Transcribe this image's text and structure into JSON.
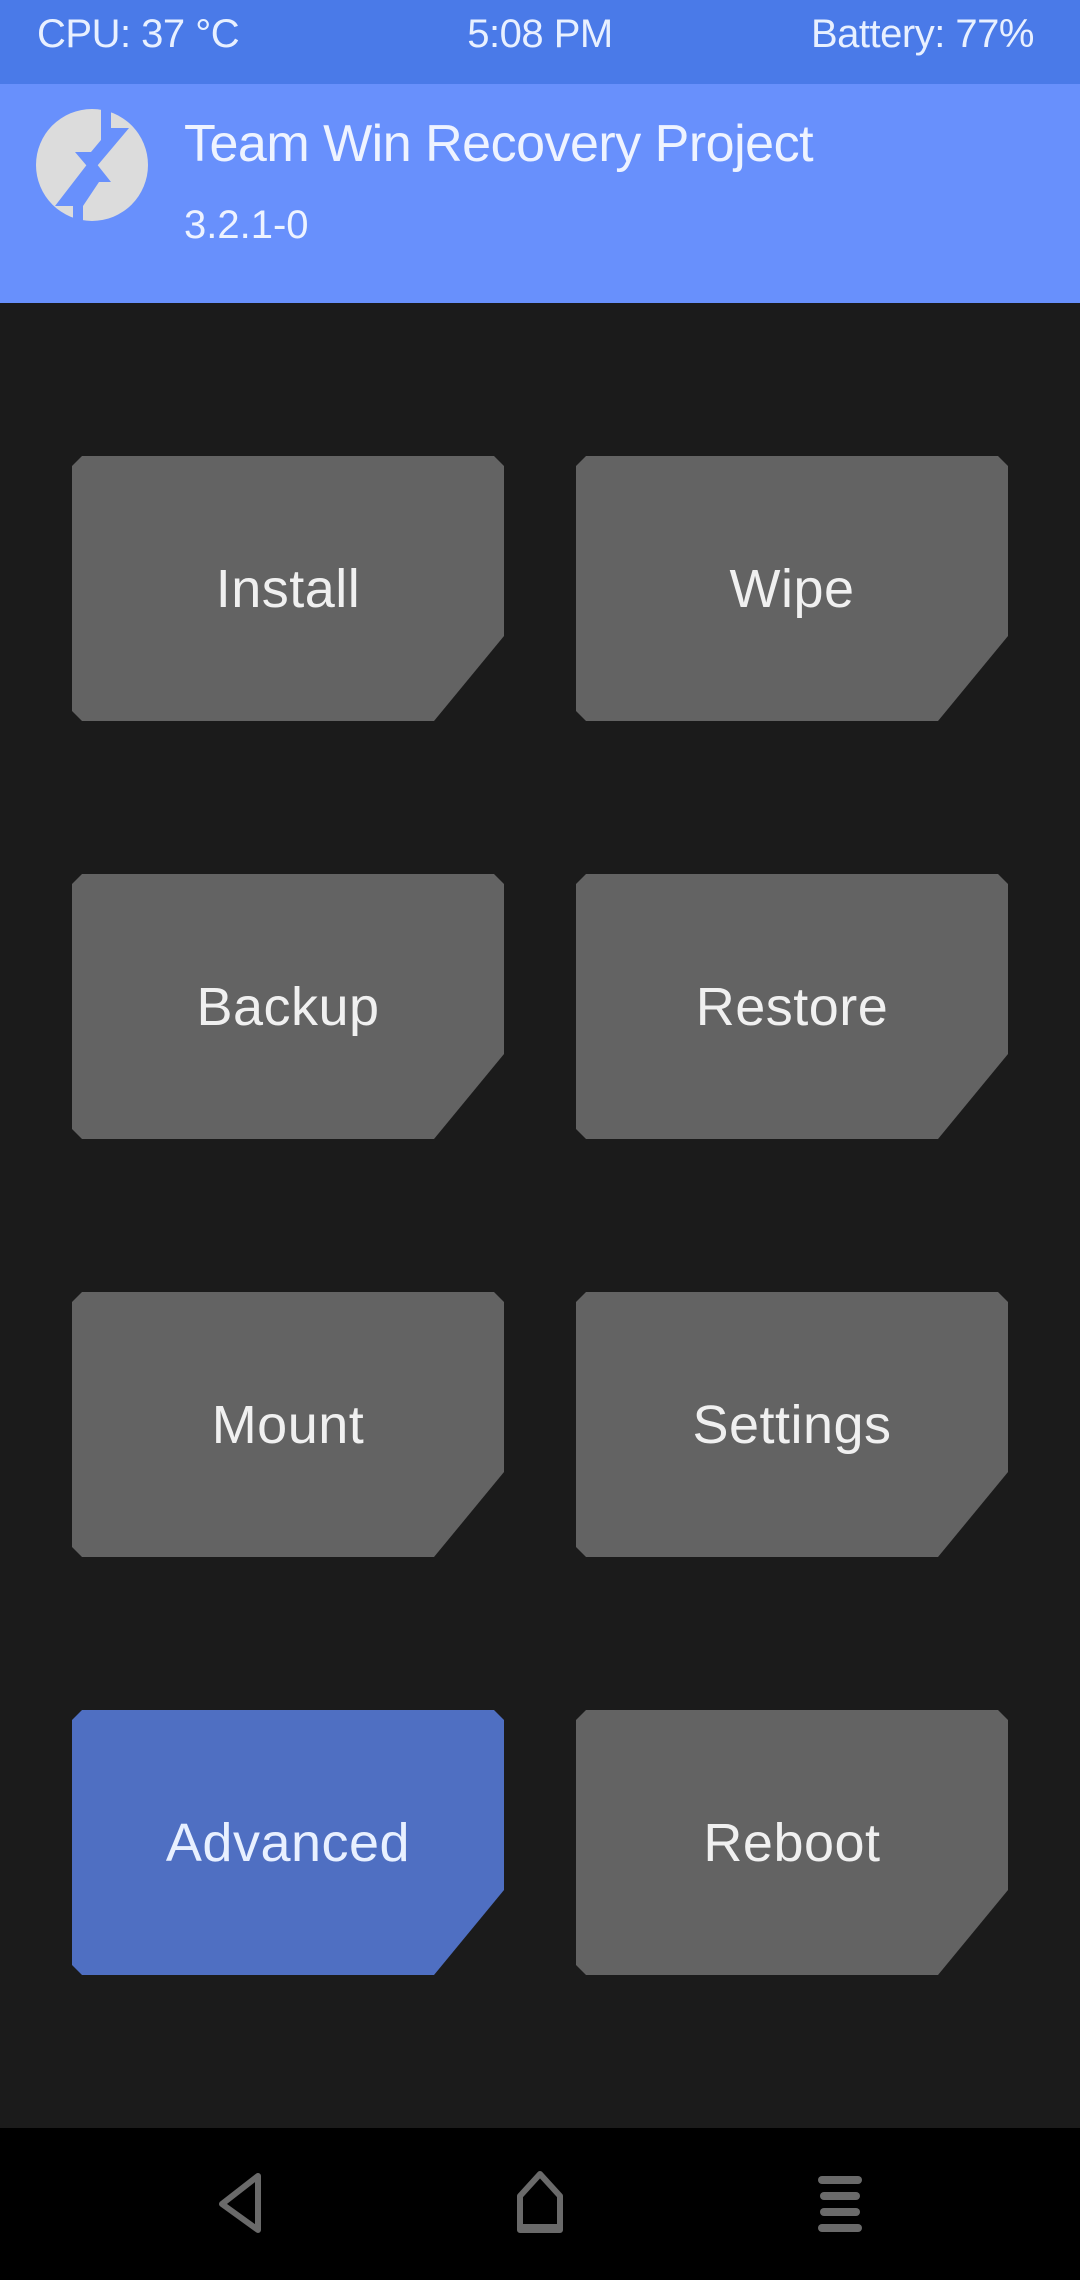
{
  "status_bar": {
    "cpu": "CPU: 37 °C",
    "time": "5:08 PM",
    "battery": "Battery: 77%"
  },
  "header": {
    "logo_icon": "twrp-logo-icon",
    "title": "Team Win Recovery Project",
    "version": "3.2.1-0"
  },
  "colors": {
    "status_bar": "#4a7ae8",
    "header": "#6890fc",
    "background": "#1b1b1b",
    "button": "#636363",
    "button_active": "#4f6fc2",
    "nav_bar": "#000000"
  },
  "menu": {
    "buttons": [
      {
        "label": "Install",
        "active": false
      },
      {
        "label": "Wipe",
        "active": false
      },
      {
        "label": "Backup",
        "active": false
      },
      {
        "label": "Restore",
        "active": false
      },
      {
        "label": "Mount",
        "active": false
      },
      {
        "label": "Settings",
        "active": false
      },
      {
        "label": "Advanced",
        "active": true
      },
      {
        "label": "Reboot",
        "active": false
      }
    ]
  },
  "nav_bar": {
    "buttons": [
      {
        "name": "back",
        "icon": "back-triangle-icon"
      },
      {
        "name": "home",
        "icon": "home-icon"
      },
      {
        "name": "console",
        "icon": "console-menu-icon"
      }
    ]
  }
}
